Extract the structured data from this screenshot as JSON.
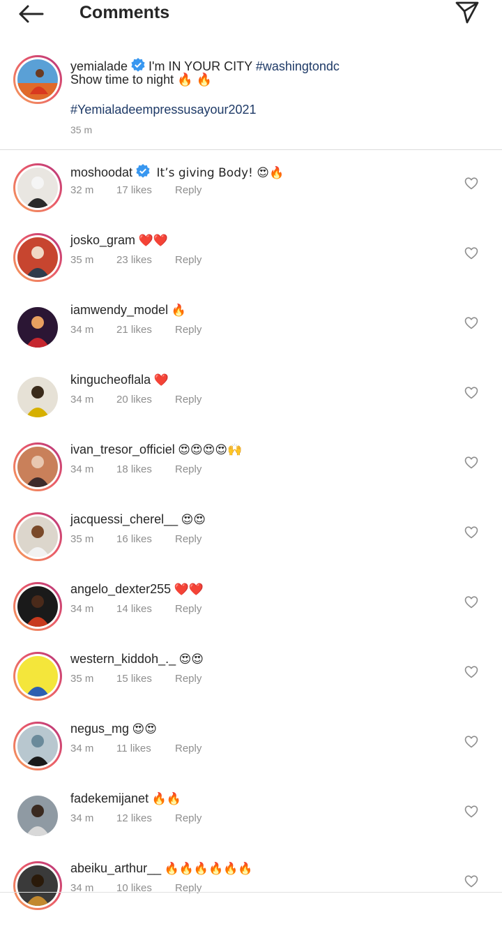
{
  "header": {
    "title": "Comments"
  },
  "caption": {
    "username": "yemialade",
    "text_line1": "I'm IN YOUR CITY ",
    "hashtag1": "#washingtondc",
    "text_line2": "Show time to night 🔥 🔥",
    "hashtag2": "#Yemialadeempressusayour2021",
    "time": "35 m"
  },
  "reply_label": "Reply",
  "comments": [
    {
      "username": "moshoodat",
      "verified": true,
      "text": "It’s giving Body! 😍🔥",
      "time": "32 m",
      "likes": "17 likes"
    },
    {
      "username": "josko_gram",
      "text": "❤️❤️",
      "time": "35 m",
      "likes": "23 likes"
    },
    {
      "username": "iamwendy_model",
      "text": "🔥",
      "time": "34 m",
      "likes": "21 likes"
    },
    {
      "username": "kingucheoflala",
      "text": "❤️",
      "time": "34 m",
      "likes": "20 likes"
    },
    {
      "username": "ivan_tresor_officiel",
      "text": "😍😍😍😍🙌",
      "time": "34 m",
      "likes": "18 likes"
    },
    {
      "username": "jacquessi_cherel__",
      "text": "😍😍",
      "time": "35 m",
      "likes": "16 likes"
    },
    {
      "username": "angelo_dexter255",
      "text": "❤️❤️",
      "time": "34 m",
      "likes": "14 likes"
    },
    {
      "username": "western_kiddoh_._",
      "text": "😍😍",
      "time": "35 m",
      "likes": "15 likes"
    },
    {
      "username": "negus_mg",
      "text": "😍😍",
      "time": "34 m",
      "likes": "11 likes"
    },
    {
      "username": "fadekemijanet",
      "text": "🔥🔥",
      "time": "34 m",
      "likes": "12 likes"
    },
    {
      "username": "abeiku_arthur__",
      "text": "🔥🔥🔥🔥🔥🔥",
      "time": "34 m",
      "likes": "10 likes"
    }
  ],
  "colors": {
    "hashtag": "#1e3a67",
    "verified": "#3897f0",
    "muted": "#8e8e8e",
    "story_ring_start": "#f6a25b",
    "story_ring_end": "#b3317c"
  }
}
